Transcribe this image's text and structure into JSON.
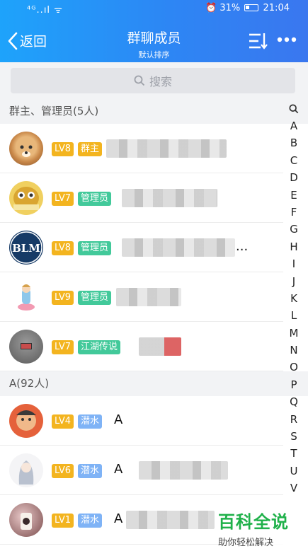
{
  "status_bar": {
    "left": "⁴ᴳ..ıl ᯤ",
    "battery": "31%",
    "time": "21:04"
  },
  "header": {
    "back_label": "返回",
    "title": "群聊成员",
    "subtitle": "默认排序"
  },
  "search": {
    "placeholder": "搜索"
  },
  "sections": [
    {
      "title": "群主、管理员(5人)"
    },
    {
      "title": "A(92人)"
    }
  ],
  "members": [
    {
      "level": "LV8",
      "role": "群主",
      "name": "",
      "tag_color": "#f3b41f"
    },
    {
      "level": "LV7",
      "role": "管理员",
      "name": "",
      "tag_color": "#42c99a"
    },
    {
      "level": "LV8",
      "role": "管理员",
      "name": "...",
      "tag_color": "#42c99a"
    },
    {
      "level": "LV9",
      "role": "管理员",
      "name": "",
      "tag_color": "#42c99a"
    },
    {
      "level": "LV7",
      "role": "江湖传说",
      "name": "",
      "tag_color": "#42c99a"
    },
    {
      "level": "LV4",
      "role": "潜水",
      "name": "A",
      "tag_color": "#7fb3f6"
    },
    {
      "level": "LV6",
      "role": "潜水",
      "name": "A",
      "tag_color": "#7fb3f6"
    },
    {
      "level": "LV1",
      "role": "潜水",
      "name": "A",
      "tag_color": "#7fb3f6"
    }
  ],
  "index_letters": [
    "A",
    "B",
    "C",
    "D",
    "E",
    "F",
    "G",
    "H",
    "I",
    "J",
    "K",
    "L",
    "M",
    "N",
    "O",
    "P",
    "Q",
    "R",
    "S",
    "T",
    "U",
    "V"
  ],
  "watermark": {
    "brand": "百科全说",
    "slogan": "助你轻松解决"
  },
  "colors": {
    "header_start": "#1ea3fb",
    "header_end": "#3a77ef",
    "level_badge": "#f3b41f"
  }
}
